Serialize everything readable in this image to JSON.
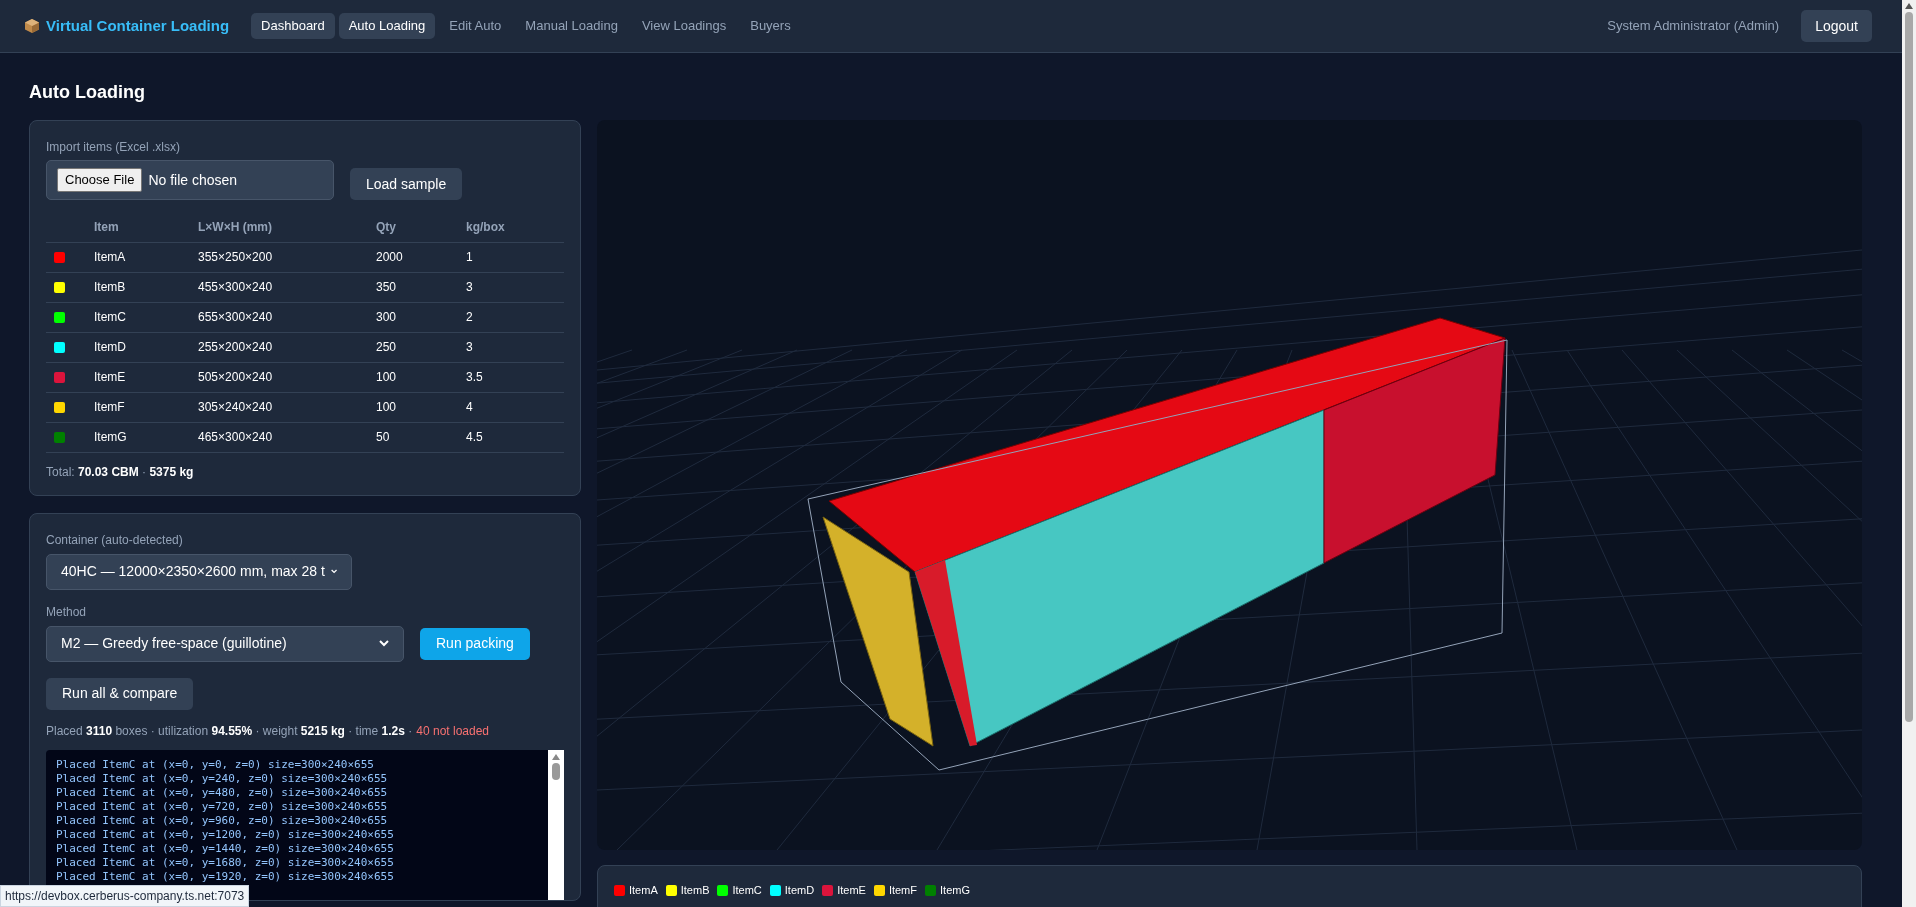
{
  "app": {
    "title": "Virtual Container Loading"
  },
  "nav": [
    {
      "label": "Dashboard",
      "active": true
    },
    {
      "label": "Auto Loading",
      "active": true
    },
    {
      "label": "Edit Auto",
      "active": false
    },
    {
      "label": "Manual Loading",
      "active": false
    },
    {
      "label": "View Loadings",
      "active": false
    },
    {
      "label": "Buyers",
      "active": false
    }
  ],
  "user": "System Administrator (Admin)",
  "logout": "Logout",
  "page_title": "Auto Loading",
  "import": {
    "label": "Import items (Excel .xlsx)",
    "file_button": "Choose File",
    "file_status": "No file chosen",
    "load_sample": "Load sample"
  },
  "items_table": {
    "columns": [
      "Item",
      "L×W×H (mm)",
      "Qty",
      "kg/box"
    ],
    "rows": [
      {
        "color": "#ff0000",
        "item": "ItemA",
        "dims": "355×250×200",
        "qty": "2000",
        "kg": "1"
      },
      {
        "color": "#ffff00",
        "item": "ItemB",
        "dims": "455×300×240",
        "qty": "350",
        "kg": "3"
      },
      {
        "color": "#00ff00",
        "item": "ItemC",
        "dims": "655×300×240",
        "qty": "300",
        "kg": "2"
      },
      {
        "color": "#00ffff",
        "item": "ItemD",
        "dims": "255×200×240",
        "qty": "250",
        "kg": "3"
      },
      {
        "color": "#dc143c",
        "item": "ItemE",
        "dims": "505×200×240",
        "qty": "100",
        "kg": "3.5"
      },
      {
        "color": "#ffd700",
        "item": "ItemF",
        "dims": "305×240×240",
        "qty": "100",
        "kg": "4"
      },
      {
        "color": "#008000",
        "item": "ItemG",
        "dims": "465×300×240",
        "qty": "50",
        "kg": "4.5"
      }
    ]
  },
  "total": "Total: **70.03 CBM** · **5375 kg**",
  "container": {
    "label": "Container (auto-detected)",
    "value": "40HC — 12000×2350×2600 mm, max 28 t"
  },
  "method": {
    "label": "Method",
    "value": "M2 — Greedy free-space (guillotine)",
    "run": "Run packing",
    "compare": "Run all & compare"
  },
  "summary": "Placed **3110** boxes · utilization **94.55%** · weight **5215 kg** · time **1.2s** ·",
  "not_loaded": "40 not loaded",
  "log": [
    "Placed ItemC at (x=0, y=0, z=0) size=300×240×655",
    "Placed ItemC at (x=0, y=240, z=0) size=300×240×655",
    "Placed ItemC at (x=0, y=480, z=0) size=300×240×655",
    "Placed ItemC at (x=0, y=720, z=0) size=300×240×655",
    "Placed ItemC at (x=0, y=960, z=0) size=300×240×655",
    "Placed ItemC at (x=0, y=1200, z=0) size=300×240×655",
    "Placed ItemC at (x=0, y=1440, z=0) size=300×240×655",
    "Placed ItemC at (x=0, y=1680, z=0) size=300×240×655",
    "Placed ItemC at (x=0, y=1920, z=0) size=300×240×655"
  ],
  "legend": [
    {
      "label": "ItemA",
      "color": "#ff0000"
    },
    {
      "label": "ItemB",
      "color": "#ffff00"
    },
    {
      "label": "ItemC",
      "color": "#00ff00"
    },
    {
      "label": "ItemD",
      "color": "#00ffff"
    },
    {
      "label": "ItemE",
      "color": "#dc143c"
    },
    {
      "label": "ItemF",
      "color": "#ffd700"
    },
    {
      "label": "ItemG",
      "color": "#008000"
    }
  ],
  "status_url": "https://devbox.cerberus-company.ts.net:7073"
}
